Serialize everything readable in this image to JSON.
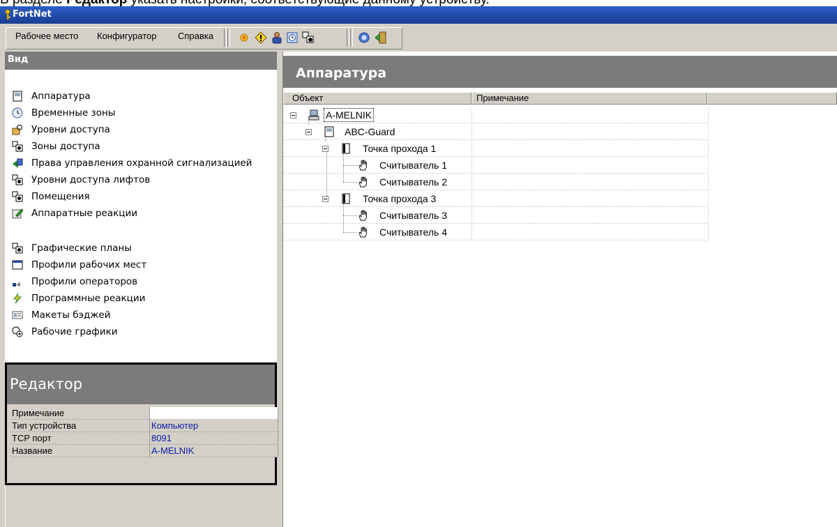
{
  "caption": {
    "prefix": "В разделе ",
    "bold": "Редактор",
    "suffix": " указать настройки, соответствующие данному устройству."
  },
  "window": {
    "title": "FortNet"
  },
  "menu": {
    "items": [
      "Рабочее место",
      "Конфигуратор",
      "Справка"
    ]
  },
  "toolbar": {
    "icons": [
      "sun-icon",
      "warning-diamond-icon",
      "person-icon",
      "clock-icon",
      "zones-icon",
      "help-icon",
      "exit-icon"
    ]
  },
  "view_panel": {
    "title": "Вид",
    "group1": [
      {
        "label": "Аппаратура",
        "icon": "hardware-icon"
      },
      {
        "label": "Временные зоны",
        "icon": "clock-icon"
      },
      {
        "label": "Уровни доступа",
        "icon": "key-lock-icon"
      },
      {
        "label": "Зоны доступа",
        "icon": "zones-icon"
      },
      {
        "label": "Права управления охранной сигнализацией",
        "icon": "alarm-rights-icon"
      },
      {
        "label": "Уровни доступа лифтов",
        "icon": "zones-icon"
      },
      {
        "label": "Помещения",
        "icon": "zones-icon"
      },
      {
        "label": "Аппаратные реакции",
        "icon": "reaction-edit-icon"
      }
    ],
    "group2": [
      {
        "label": "Графические планы",
        "icon": "zones-icon"
      },
      {
        "label": "Профили рабочих мест",
        "icon": "window-icon"
      },
      {
        "label": "Профили операторов",
        "icon": "operator-icon"
      },
      {
        "label": "Программные реакции",
        "icon": "lightning-icon"
      },
      {
        "label": "Макеты бэджей",
        "icon": "badge-icon"
      },
      {
        "label": "Рабочие графики",
        "icon": "schedule-icon"
      }
    ]
  },
  "editor": {
    "title": "Редактор",
    "rows": [
      {
        "key": "Примечание",
        "value": ""
      },
      {
        "key": "Тип устройства",
        "value": "Компьютер"
      },
      {
        "key": "TCP порт",
        "value": "8091"
      },
      {
        "key": "Название",
        "value": "A-MELNIK"
      }
    ]
  },
  "hardware_panel": {
    "title": "Аппаратура",
    "columns": [
      "Объект",
      "Примечание"
    ],
    "tree": [
      {
        "label": "A-MELNIK",
        "icon": "computer-icon",
        "level": 0,
        "expander": true,
        "selected": true
      },
      {
        "label": "ABC-Guard",
        "icon": "controller-icon",
        "level": 1,
        "expander": true
      },
      {
        "label": "Точка прохода 1",
        "icon": "door-icon",
        "level": 2,
        "expander": true
      },
      {
        "label": "Считыватель 1",
        "icon": "hand-reader-icon",
        "level": 3
      },
      {
        "label": "Считыватель 2",
        "icon": "hand-reader-icon",
        "level": 3
      },
      {
        "label": "Точка прохода 3",
        "icon": "door-icon",
        "level": 2,
        "expander": true
      },
      {
        "label": "Считыватель 3",
        "icon": "hand-reader-icon",
        "level": 3
      },
      {
        "label": "Считыватель 4",
        "icon": "hand-reader-icon",
        "level": 3
      }
    ]
  },
  "colors": {
    "title_bar": "#1f49a6",
    "panel_header": "#7b7b7b",
    "chrome": "#d4d0c8",
    "value_text": "#0a1aa8"
  }
}
